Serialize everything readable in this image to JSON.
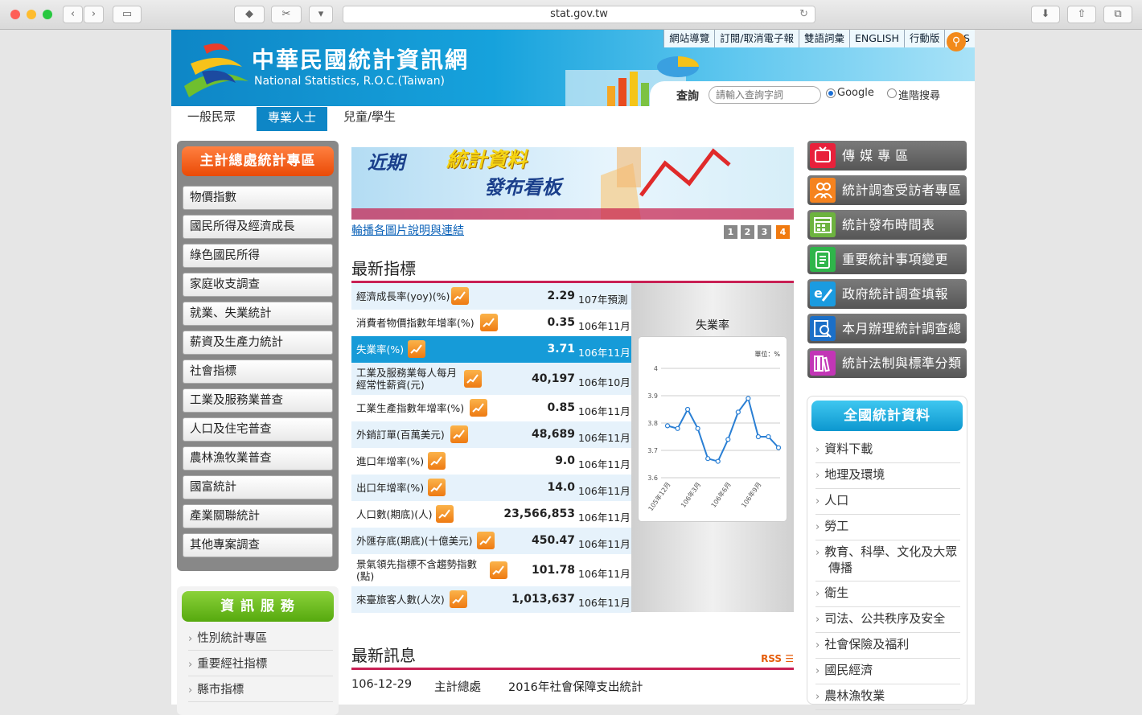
{
  "browser": {
    "url": "stat.gov.tw"
  },
  "header": {
    "logo_cn": "中華民國統計資訊網",
    "logo_en": "National Statistics, R.O.C.(Taiwan)",
    "top_links": [
      "網站導覽",
      "訂閱/取消電子報",
      "雙語詞彙",
      "ENGLISH",
      "行動版",
      "RSS"
    ],
    "search_label": "查詢",
    "search_placeholder": "請輸入查詢字詞",
    "search_opt1": "Google",
    "search_opt2": "進階搜尋"
  },
  "tabs": [
    "一般民眾",
    "專業人士",
    "兒童/學生"
  ],
  "left_nav": {
    "title": "主計總處統計專區",
    "items": [
      "物價指數",
      "國民所得及經濟成長",
      "綠色國民所得",
      "家庭收支調查",
      "就業、失業統計",
      "薪資及生產力統計",
      "社會指標",
      "工業及服務業普查",
      "人口及住宅普查",
      "農林漁牧業普查",
      "國富統計",
      "產業關聯統計",
      "其他專案調查"
    ]
  },
  "info_service": {
    "title": "資 訊 服 務",
    "items": [
      "性別統計專區",
      "重要經社指標",
      "縣市指標"
    ]
  },
  "banner": {
    "line1": "近期",
    "line2": "統計資料",
    "line3": "發布看板",
    "caption": "輪播各圖片說明與連結",
    "pages": [
      "1",
      "2",
      "3",
      "4"
    ]
  },
  "indicators": {
    "title": "最新指標",
    "rows": [
      {
        "name": "經濟成長率(yoy)(%)",
        "value": "2.29",
        "period": "107年預測"
      },
      {
        "name": "消費者物價指數年增率(%)",
        "value": "0.35",
        "period": "106年11月"
      },
      {
        "name": "失業率(%)",
        "value": "3.71",
        "period": "106年11月"
      },
      {
        "name": "工業及服務業每人每月經常性薪資(元)",
        "value": "40,197",
        "period": "106年10月"
      },
      {
        "name": "工業生產指數年增率(%)",
        "value": "0.85",
        "period": "106年11月"
      },
      {
        "name": "外銷訂單(百萬美元)",
        "value": "48,689",
        "period": "106年11月"
      },
      {
        "name": "進口年增率(%)",
        "value": "9.0",
        "period": "106年11月"
      },
      {
        "name": "出口年增率(%)",
        "value": "14.0",
        "period": "106年11月"
      },
      {
        "name": "人口數(期底)(人)",
        "value": "23,566,853",
        "period": "106年11月"
      },
      {
        "name": "外匯存底(期底)(十億美元)",
        "value": "450.47",
        "period": "106年11月"
      },
      {
        "name": "景氣領先指標不含趨勢指數(點)",
        "value": "101.78",
        "period": "106年11月"
      },
      {
        "name": "來臺旅客人數(人次)",
        "value": "1,013,637",
        "period": "106年11月"
      }
    ]
  },
  "chart_data": {
    "type": "line",
    "title": "失業率",
    "unit_label": "單位：%",
    "x_tick_labels": [
      "105年12月",
      "106年3月",
      "106年6月",
      "106年9月"
    ],
    "y_ticks": [
      "4",
      "3.9",
      "3.8",
      "3.7",
      "3.6"
    ],
    "ylim": [
      3.6,
      4.0
    ],
    "values": [
      3.79,
      3.78,
      3.85,
      3.78,
      3.67,
      3.66,
      3.74,
      3.84,
      3.89,
      3.75,
      3.75,
      3.71
    ],
    "color": "#2a7fd4"
  },
  "news": {
    "title": "最新訊息",
    "rss": "RSS",
    "items": [
      {
        "date": "106-12-29",
        "org": "主計總處",
        "title": "2016年社會保障支出統計"
      }
    ]
  },
  "right_buttons": [
    {
      "label": "傳 媒 專 區",
      "color": "#e8213b"
    },
    {
      "label": "統計調查受訪者專區",
      "color": "#f5831f"
    },
    {
      "label": "統計發布時間表",
      "color": "#6db33f"
    },
    {
      "label": "重要統計事項變更",
      "color": "#2fb54a"
    },
    {
      "label": "政府統計調查填報",
      "color": "#1a9be0"
    },
    {
      "label": "本月辦理統計調查總覽",
      "color": "#1b6fc7"
    },
    {
      "label": "統計法制與標準分類",
      "color": "#c236b6"
    }
  ],
  "national": {
    "title": "全國統計資料",
    "items": [
      "資料下載",
      "地理及環境",
      "人口",
      "勞工",
      "教育、科學、文化及大眾傳播",
      "衛生",
      "司法、公共秩序及安全",
      "社會保險及福利",
      "國民經濟",
      "農林漁牧業"
    ]
  }
}
